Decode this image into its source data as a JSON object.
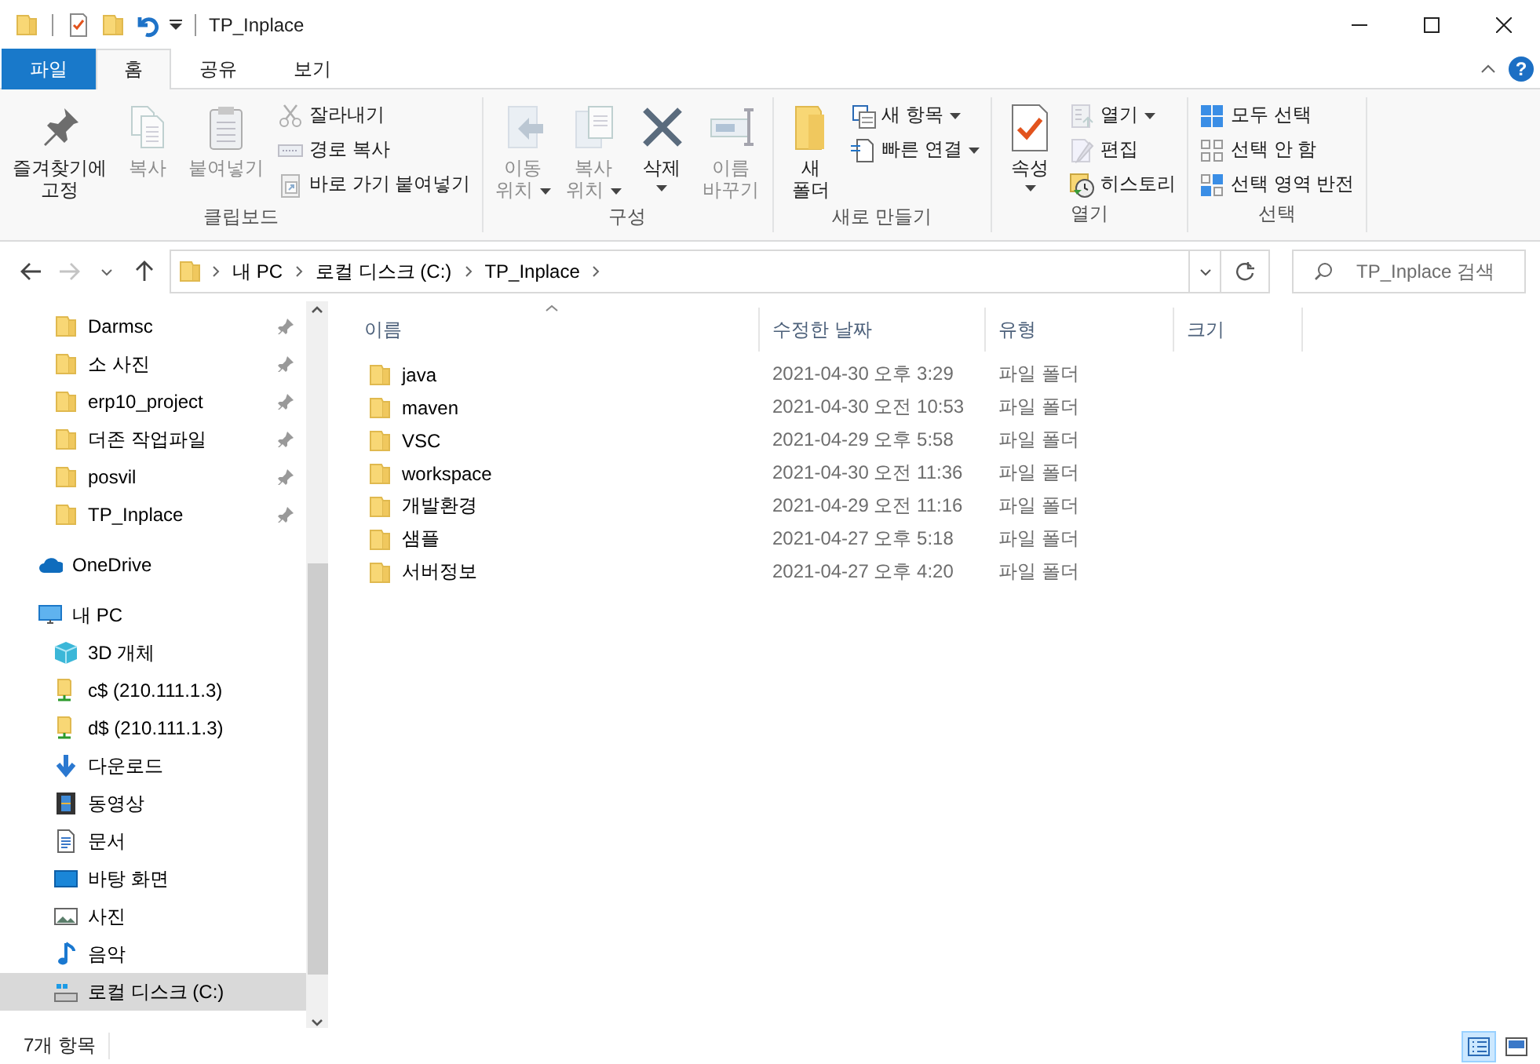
{
  "window": {
    "title": "TP_Inplace"
  },
  "ribbon_tabs": [
    {
      "label": "파일",
      "kind": "file",
      "selected": false
    },
    {
      "label": "홈",
      "kind": "tab",
      "selected": true
    },
    {
      "label": "공유",
      "kind": "tab",
      "selected": false
    },
    {
      "label": "보기",
      "kind": "tab",
      "selected": false
    }
  ],
  "help_button": "?",
  "ribbon_groups": [
    {
      "label": "클립보드",
      "items": [
        {
          "kind": "large",
          "label": "즐겨찾기에\n고정",
          "disabled": false
        },
        {
          "kind": "large",
          "label": "복사",
          "disabled": true
        },
        {
          "kind": "large",
          "label": "붙여넣기",
          "disabled": true
        },
        {
          "kind": "stack",
          "items": [
            {
              "label": "잘라내기",
              "disabled": true
            },
            {
              "label": "경로 복사",
              "disabled": true
            },
            {
              "label": "바로 가기 붙여넣기",
              "disabled": true
            }
          ]
        }
      ]
    },
    {
      "label": "구성",
      "items": [
        {
          "kind": "large",
          "label": "이동\n위치",
          "dropdown": true,
          "disabled": true
        },
        {
          "kind": "large",
          "label": "복사\n위치",
          "dropdown": true,
          "disabled": true
        },
        {
          "kind": "large",
          "label": "삭제",
          "dropdown": true,
          "disabled": false
        },
        {
          "kind": "large",
          "label": "이름\n바꾸기",
          "disabled": true
        }
      ]
    },
    {
      "label": "새로 만들기",
      "items": [
        {
          "kind": "large",
          "label": "새\n폴더",
          "disabled": false
        },
        {
          "kind": "stack",
          "items": [
            {
              "label": "새 항목",
              "dropdown": true,
              "disabled": false
            },
            {
              "label": "빠른 연결",
              "dropdown": true,
              "disabled": false
            }
          ]
        }
      ]
    },
    {
      "label": "열기",
      "items": [
        {
          "kind": "large",
          "label": "속성",
          "dropdown": true,
          "disabled": false
        },
        {
          "kind": "stack",
          "items": [
            {
              "label": "열기",
              "dropdown": true,
              "disabled": true
            },
            {
              "label": "편집",
              "disabled": true
            },
            {
              "label": "히스토리",
              "disabled": false
            }
          ]
        }
      ]
    },
    {
      "label": "선택",
      "items": [
        {
          "kind": "stack",
          "items": [
            {
              "label": "모두 선택",
              "disabled": false
            },
            {
              "label": "선택 안 함",
              "disabled": false
            },
            {
              "label": "선택 영역 반전",
              "disabled": false
            }
          ]
        }
      ]
    }
  ],
  "address_bar": {
    "forward_disabled": true,
    "crumbs": [
      "내 PC",
      "로컬 디스크 (C:)",
      "TP_Inplace"
    ]
  },
  "search": {
    "placeholder": "TP_Inplace 검색"
  },
  "navigation": {
    "pinned": [
      {
        "label": "Darmsc",
        "pinned": true,
        "selected": false
      },
      {
        "label": "소 사진",
        "pinned": true,
        "selected": false
      },
      {
        "label": "erp10_project",
        "pinned": true,
        "selected": false
      },
      {
        "label": "더존 작업파일",
        "pinned": true,
        "selected": false
      },
      {
        "label": "posvil",
        "pinned": true,
        "selected": false
      },
      {
        "label": "TP_Inplace",
        "pinned": true,
        "selected": false
      }
    ],
    "locations": [
      {
        "label": "OneDrive",
        "kind": "cloud",
        "selected": false
      },
      {
        "label": "내 PC",
        "kind": "pc",
        "selected": false,
        "children": [
          {
            "label": "3D 개체",
            "kind": "cube",
            "selected": false
          },
          {
            "label": "c$ (210.111.1.3)",
            "kind": "netdrive",
            "selected": false
          },
          {
            "label": "d$ (210.111.1.3)",
            "kind": "netdrive",
            "selected": false
          },
          {
            "label": "다운로드",
            "kind": "download",
            "selected": false
          },
          {
            "label": "동영상",
            "kind": "video",
            "selected": false
          },
          {
            "label": "문서",
            "kind": "document",
            "selected": false
          },
          {
            "label": "바탕 화면",
            "kind": "desktop",
            "selected": false
          },
          {
            "label": "사진",
            "kind": "picture",
            "selected": false
          },
          {
            "label": "음악",
            "kind": "music",
            "selected": false
          },
          {
            "label": "로컬 디스크 (C:)",
            "kind": "disk",
            "selected": true
          }
        ]
      }
    ]
  },
  "file_list": {
    "columns": [
      "이름",
      "수정한 날짜",
      "유형",
      "크기"
    ],
    "rows": [
      {
        "name": "java",
        "modified": "2021-04-30 오후 3:29",
        "type": "파일 폴더"
      },
      {
        "name": "maven",
        "modified": "2021-04-30 오전 10:53",
        "type": "파일 폴더"
      },
      {
        "name": "VSC",
        "modified": "2021-04-29 오후 5:58",
        "type": "파일 폴더"
      },
      {
        "name": "workspace",
        "modified": "2021-04-30 오전 11:36",
        "type": "파일 폴더"
      },
      {
        "name": "개발환경",
        "modified": "2021-04-29 오전 11:16",
        "type": "파일 폴더"
      },
      {
        "name": "샘플",
        "modified": "2021-04-27 오후 5:18",
        "type": "파일 폴더"
      },
      {
        "name": "서버정보",
        "modified": "2021-04-27 오후 4:20",
        "type": "파일 폴더"
      }
    ]
  },
  "status_bar": {
    "item_count": "7개 항목",
    "views": [
      {
        "kind": "details",
        "selected": true
      },
      {
        "kind": "large_icons",
        "selected": false
      }
    ]
  }
}
